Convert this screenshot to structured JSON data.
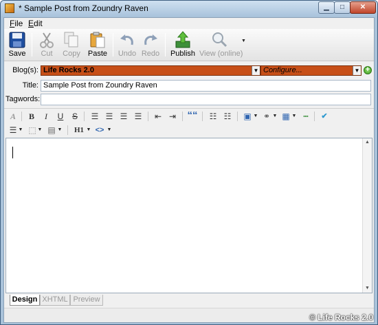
{
  "window": {
    "title": "* Sample Post from Zoundry Raven"
  },
  "menubar": {
    "items": [
      {
        "label": "File"
      },
      {
        "label": "Edit"
      }
    ]
  },
  "toolbar": {
    "save": {
      "label": "Save",
      "icon": "save-icon"
    },
    "cut": {
      "label": "Cut",
      "icon": "scissors-icon"
    },
    "copy": {
      "label": "Copy",
      "icon": "copy-icon"
    },
    "paste": {
      "label": "Paste",
      "icon": "paste-icon"
    },
    "undo": {
      "label": "Undo",
      "icon": "undo-icon"
    },
    "redo": {
      "label": "Redo",
      "icon": "redo-icon"
    },
    "publish": {
      "label": "Publish",
      "icon": "publish-icon"
    },
    "view_online": {
      "label": "View (online)",
      "icon": "magnifier-icon"
    }
  },
  "form": {
    "blogs_label": "Blog(s):",
    "blog_value": "Life Rocks 2.0",
    "configure_value": "Configure...",
    "title_label": "Title:",
    "title_value": "Sample Post from Zoundry Raven",
    "tagwords_label": "Tagwords:",
    "tagwords_value": ""
  },
  "format": {
    "font": "A",
    "bold": "B",
    "italic": "I",
    "underline": "U",
    "strike": "S",
    "blockquote": "““",
    "heading": "H1",
    "code": "<>"
  },
  "tabs": [
    {
      "label": "Design",
      "active": true
    },
    {
      "label": "XHTML",
      "active": false
    },
    {
      "label": "Preview",
      "active": false
    }
  ],
  "watermark": "© Life Rocks 2.0",
  "colors": {
    "titlebar": "#b7cde3",
    "blog_field": "#c74f17",
    "link_blue": "#2f65b0"
  }
}
